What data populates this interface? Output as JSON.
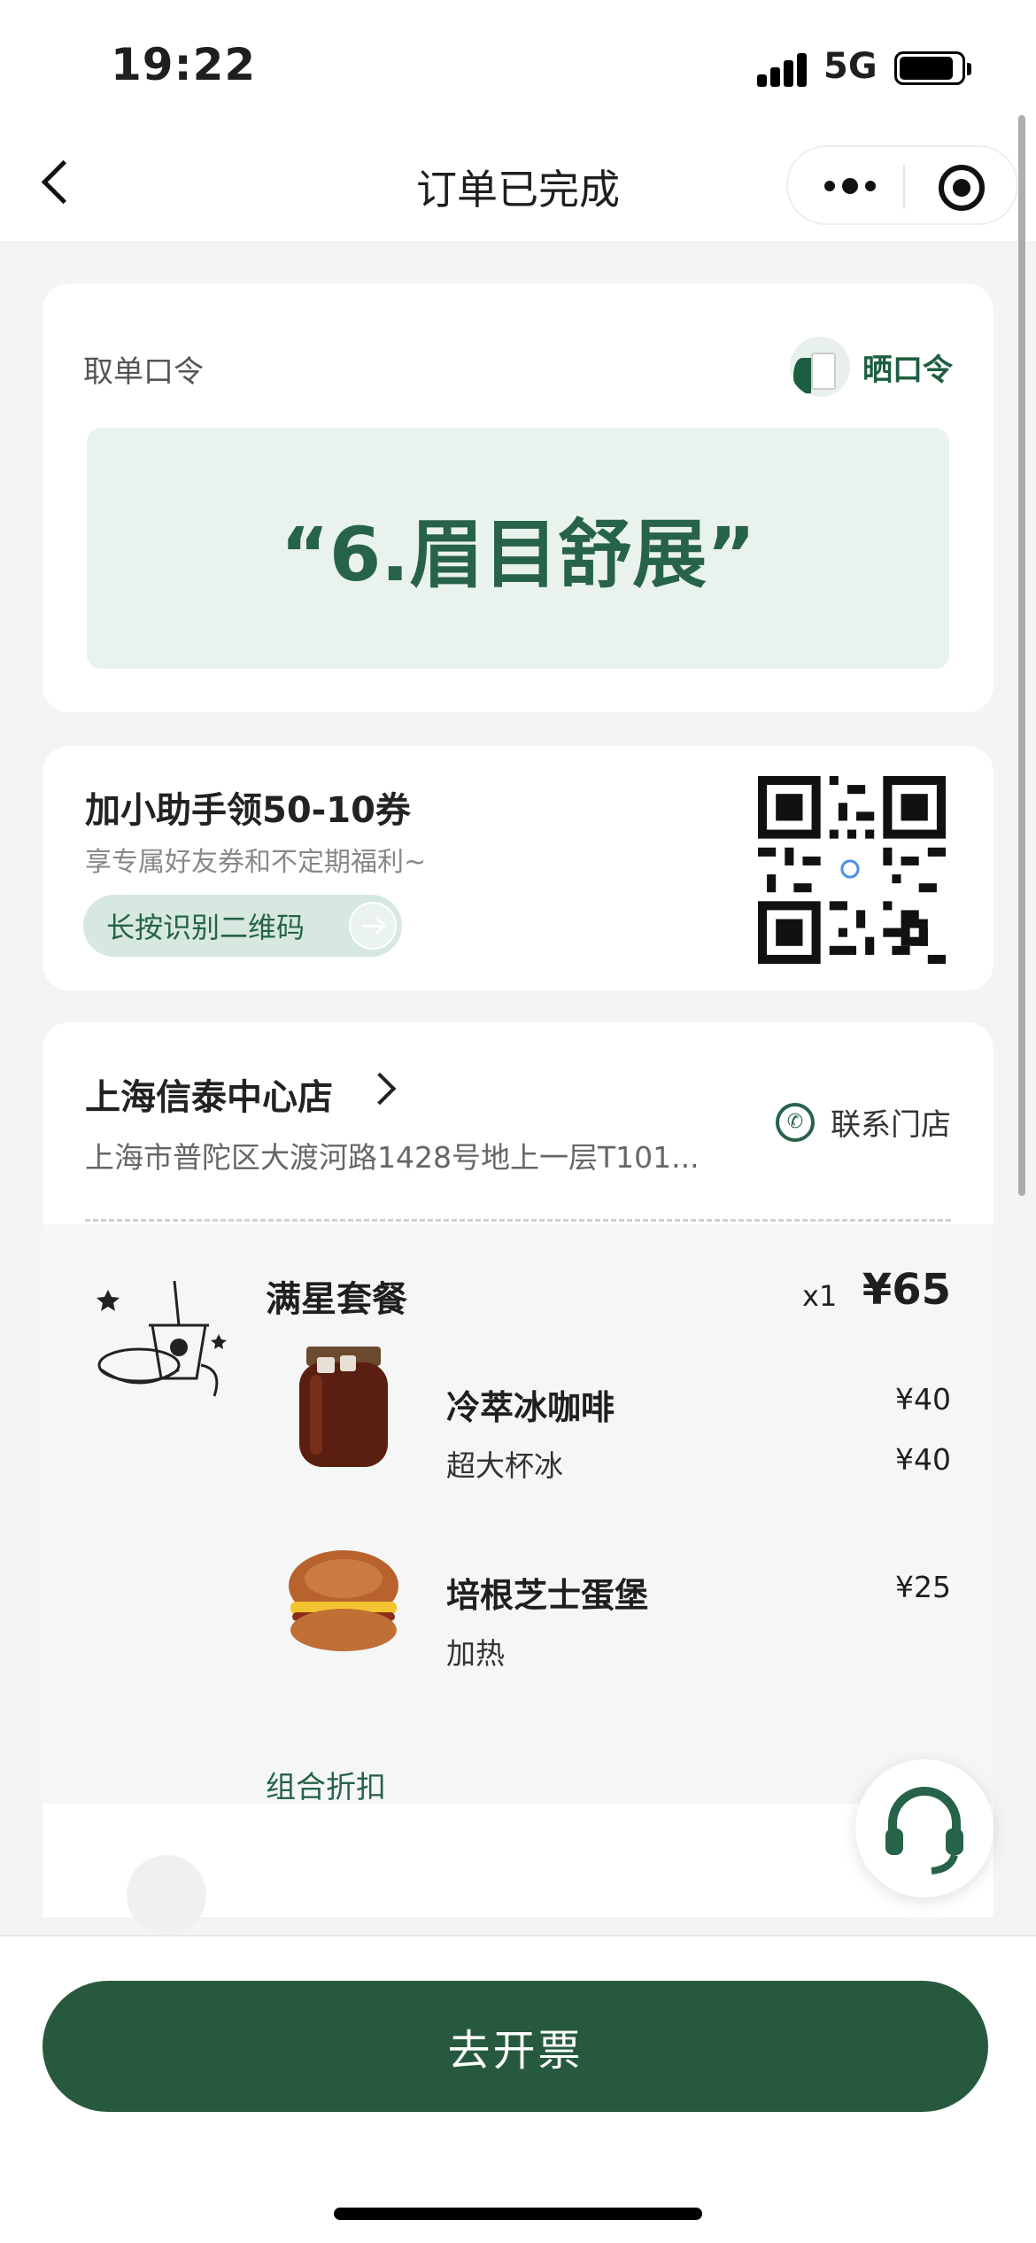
{
  "status_bar": {
    "time": "19:22",
    "network": "5G"
  },
  "nav": {
    "title": "订单已完成"
  },
  "pickup": {
    "label": "取单口令",
    "share_label": "晒口令",
    "password": "“6.眉目舒展”"
  },
  "promo": {
    "title": "加小助手领50-10券",
    "subtitle": "享专属好友券和不定期福利~",
    "button_label": "长按识别二维码"
  },
  "store": {
    "name": "上海信泰中心店",
    "address": "上海市普陀区大渡河路1428号地上一层T101...",
    "contact_label": "联系门店"
  },
  "order": {
    "combo": {
      "name": "满星套餐",
      "qty": "x1",
      "price": "¥65"
    },
    "items": [
      {
        "name": "冷萃冰咖啡",
        "spec": "超大杯冰",
        "price": "¥40",
        "spec_price": "¥40"
      },
      {
        "name": "培根芝士蛋堡",
        "spec": "加热",
        "price": "¥25"
      }
    ],
    "discount_label": "组合折扣"
  },
  "bottom": {
    "invoice_label": "去开票"
  },
  "colors": {
    "brand_green": "#27593f",
    "accent_green": "#276349",
    "soft_green": "#eaf2ee"
  },
  "icons": [
    "back-icon",
    "more-icon",
    "target-icon",
    "share-avatar-icon",
    "arrow-right-icon",
    "qr-code-icon",
    "chevron-right-icon",
    "phone-icon",
    "headset-icon"
  ]
}
